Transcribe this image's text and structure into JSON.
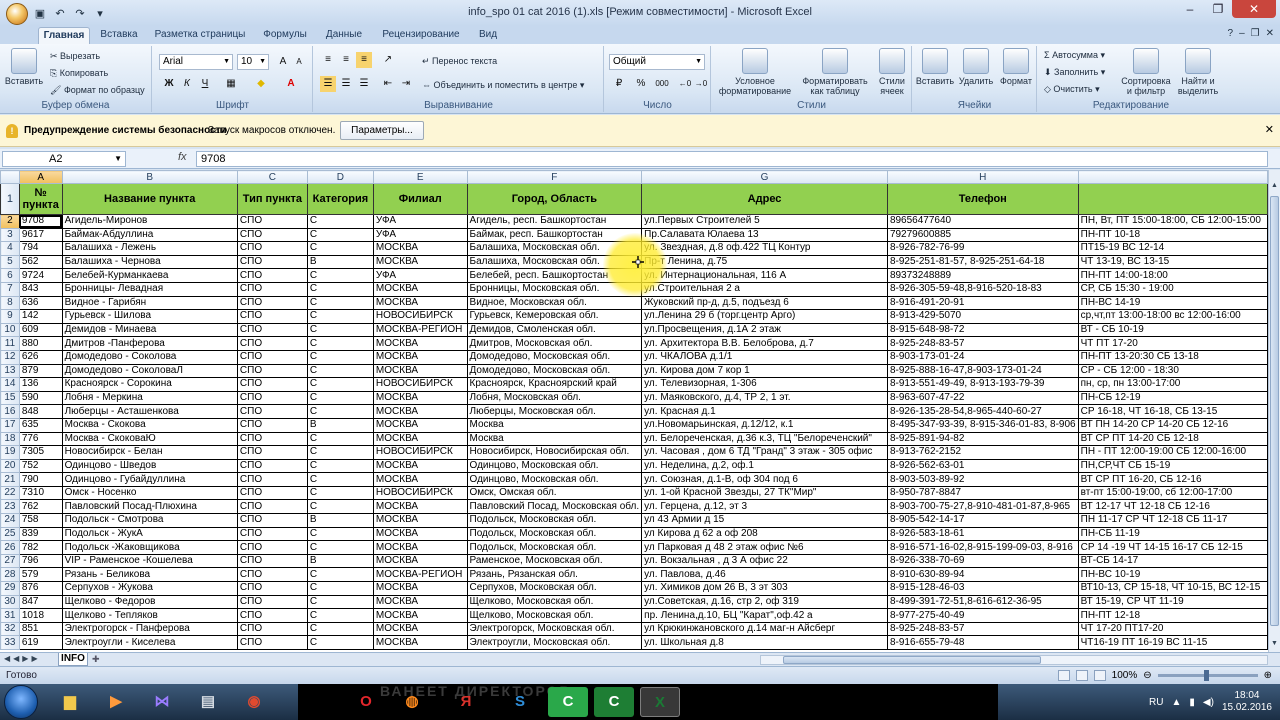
{
  "window": {
    "title": "info_spo 01 cat 2016 (1).xls [Режим совместимости] - Microsoft Excel",
    "quick_access": [
      "save-icon",
      "undo-icon",
      "redo-icon"
    ]
  },
  "ribbon_tabs": [
    "Главная",
    "Вставка",
    "Разметка страницы",
    "Формулы",
    "Данные",
    "Рецензирование",
    "Вид"
  ],
  "ribbon": {
    "clipboard": {
      "paste": "Вставить",
      "cut": "Вырезать",
      "copy": "Копировать",
      "format_painter": "Формат по образцу",
      "label": "Буфер обмена"
    },
    "font": {
      "name": "Arial",
      "size": "10",
      "bold": "Ж",
      "italic": "К",
      "underline": "Ч",
      "label": "Шрифт"
    },
    "alignment": {
      "wrap": "Перенос текста",
      "merge": "Объединить и поместить в центре",
      "label": "Выравнивание"
    },
    "number": {
      "format": "Общий",
      "percent": "%",
      "thousands": "000",
      "label": "Число"
    },
    "styles": {
      "conditional": "Условное форматирование",
      "table": "Форматировать как таблицу",
      "cell": "Стили ячеек",
      "label": "Стили"
    },
    "cells": {
      "insert": "Вставить",
      "delete": "Удалить",
      "format": "Формат",
      "label": "Ячейки"
    },
    "editing": {
      "autosum": "Автосумма",
      "fill": "Заполнить",
      "clear": "Очистить",
      "sort": "Сортировка и фильтр",
      "find": "Найти и выделить",
      "label": "Редактирование"
    }
  },
  "security_bar": {
    "title": "Предупреждение системы безопасности",
    "text": "Запуск макросов отключен.",
    "button": "Параметры..."
  },
  "formula_bar": {
    "name_box": "A2",
    "fx": "fx",
    "content": "9708"
  },
  "columns": [
    "A",
    "B",
    "C",
    "D",
    "E",
    "F",
    "G",
    "H"
  ],
  "header_row": [
    "№ пункта",
    "Название пункта",
    "Тип пункта",
    "Категория",
    "Филиал",
    "Город, Область",
    "Адрес",
    "Телефон",
    ""
  ],
  "rows": [
    [
      "9708",
      "Агидель-Миронов",
      "СПО",
      "С",
      "УФА",
      "Агидель, респ. Башкортостан",
      "ул.Первых Строителей 5",
      "89656477640",
      "ПН, Вт, ПТ 15:00-18:00, СБ 12:00-15:00"
    ],
    [
      "9617",
      "Баймак-Абдуллина",
      "СПО",
      "С",
      "УФА",
      "Баймак, респ. Башкортостан",
      "Пр.Салавата Юлаева 13",
      "79279600885",
      "ПН-ПТ 10-18"
    ],
    [
      "794",
      "Балашиха - Лежень",
      "СПО",
      "С",
      "МОСКВА",
      "Балашиха, Московская обл.",
      "ул. Звездная, д.8 оф.422 ТЦ Контур",
      "8-926-782-76-99",
      "ПТ15-19  ВС 12-14"
    ],
    [
      "562",
      "Балашиха - Чернова",
      "СПО",
      "В",
      "МОСКВА",
      "Балашиха, Московская обл.",
      "Пр-т Ленина, д.75",
      "8-925-251-81-57, 8-925-251-64-18",
      "ЧТ 13-19, ВС 13-15"
    ],
    [
      "9724",
      "Белебей-Курманкаева",
      "СПО",
      "С",
      "УФА",
      "Белебей, респ. Башкортостан",
      "ул. Интернациональная, 116 А",
      "89373248889",
      "ПН-ПТ 14:00-18:00"
    ],
    [
      "843",
      "Бронницы- Левадная",
      "СПО",
      "С",
      "МОСКВА",
      "Бронницы, Московская обл.",
      "ул.Строительная  2 а",
      "8-926-305-59-48,8-916-520-18-83",
      "СР, СБ 15:30 - 19:00"
    ],
    [
      "636",
      "Видное - Гарибян",
      "СПО",
      "С",
      "МОСКВА",
      "Видное, Московская обл.",
      "Жуковский пр-д, д.5, подъезд 6",
      "8-916-491-20-91",
      "ПН-ВС 14-19"
    ],
    [
      "142",
      "Гурьевск - Шилова",
      "СПО",
      "С",
      "НОВОСИБИРСК",
      "Гурьевск, Кемеровская обл.",
      "ул.Ленина 29 б (торг.центр Арго)",
      "8-913-429-5070",
      "ср,чт,пт 13:00-18:00 вс 12:00-16:00"
    ],
    [
      "609",
      "Демидов - Минаева",
      "СПО",
      "С",
      "МОСКВА-РЕГИОН",
      "Демидов, Смоленская обл.",
      "ул.Просвещения, д.1А   2 этаж",
      "8-915-648-98-72",
      "ВТ - СБ 10-19"
    ],
    [
      "880",
      "Дмитров -Панферова",
      "СПО",
      "С",
      "МОСКВА",
      "Дмитров, Московская обл.",
      "  ул. Архитектора В.В. Белоброва, д.7",
      "8-925-248-83-57",
      "ЧТ ПТ 17-20"
    ],
    [
      "626",
      "Домодедово - Соколова",
      "СПО",
      "С",
      "МОСКВА",
      "Домодедово, Московская обл.",
      "ул. ЧКАЛОВА  д.1/1",
      "8-903-173-01-24",
      "ПН-ПТ 13-20:30 СБ 13-18"
    ],
    [
      "879",
      "Домодедово - СоколоваЛ",
      "СПО",
      "С",
      "МОСКВА",
      "Домодедово, Московская обл.",
      "ул. Кирова дом 7 кор 1",
      "8-925-888-16-47,8-903-173-01-24",
      "СР - СБ 12:00 - 18:30"
    ],
    [
      "136",
      "Красноярск - Сорокина",
      "СПО",
      "С",
      "НОВОСИБИРСК",
      "Красноярск, Красноярский край",
      "ул. Телевизорная, 1-306",
      "8-913-551-49-49, 8-913-193-79-39",
      "пн, ср, пн 13:00-17:00"
    ],
    [
      "590",
      "Лобня - Меркина",
      "СПО",
      "С",
      "МОСКВА",
      "Лобня, Московская обл.",
      "ул. Маяковского, д.4, ТР 2, 1 эт.",
      "8-963-607-47-22",
      "ПН-СБ 12-19"
    ],
    [
      "848",
      "Люберцы - Асташенкова",
      "СПО",
      "С",
      "МОСКВА",
      "Люберцы, Московская обл.",
      "ул. Красная д.1",
      "8-926-135-28-54,8-965-440-60-27",
      "СР 16-18, ЧТ 16-18, СБ 13-15"
    ],
    [
      "635",
      "Москва - Скокова",
      "СПО",
      "В",
      "МОСКВА",
      "Москва",
      "ул.Новомарьинская, д.12/12, к.1",
      "8-495-347-93-39, 8-915-346-01-83, 8-906",
      "ВТ ПН 14-20 СР 14-20 СБ 12-16"
    ],
    [
      "776",
      "Москва - СкоковаЮ",
      "СПО",
      "С",
      "МОСКВА",
      "Москва",
      "ул. Белореченская, д.36 к.3, ТЦ \"Белореченский\"",
      "8-925-891-94-82",
      "ВТ СР ПТ 14-20 СБ 12-18"
    ],
    [
      "7305",
      "Новосибирск - Белан",
      "СПО",
      "С",
      "НОВОСИБИРСК",
      "Новосибирск, Новосибирская обл.",
      "ул. Часовая , дом 6 ТД \"Гранд\" 3 этаж - 305 офис",
      "8-913-762-2152",
      "ПН - ПТ 12:00-19:00 СБ 12:00-16:00"
    ],
    [
      "752",
      "Одинцово - Шведов",
      "СПО",
      "С",
      "МОСКВА",
      "Одинцово, Московская обл.",
      "ул. Неделина, д.2, оф.1",
      "8-926-562-63-01",
      "ПН,СР,ЧТ СБ 15-19"
    ],
    [
      "790",
      "Одинцово - Губайдуллина",
      "СПО",
      "С",
      "МОСКВА",
      "Одинцово, Московская обл.",
      "ул. Союзная, д.1-В, оф 304 под 6",
      "8-903-503-89-92",
      "ВТ СР ПТ 16-20, СБ 12-16"
    ],
    [
      "7310",
      "Омск -  Носенко",
      "СПО",
      "С",
      "НОВОСИБИРСК",
      "Омск, Омская обл.",
      "ул. 1-ой Красной Звезды, 27 ТК\"Мир\"",
      "8-950-787-8847",
      "вт-пт 15:00-19:00, сб 12:00-17:00"
    ],
    [
      "762",
      "Павловский Посад-Плюхина",
      "СПО",
      "С",
      "МОСКВА",
      "Павловский Посад, Московская обл.",
      "ул. Герцена, д.12, эт 3",
      "8-903-700-75-27,8-910-481-01-87,8-965",
      "ВТ 12-17 ЧТ 12-18 СБ 12-16"
    ],
    [
      "758",
      "Подольск - Смотрова",
      "СПО",
      "В",
      "МОСКВА",
      "Подольск, Московская обл.",
      "ул 43 Армии д 15",
      "8-905-542-14-17",
      "ПН 11-17  СР ЧТ 12-18 СБ 11-17"
    ],
    [
      "839",
      "Подольск - ЖукА",
      "СПО",
      "С",
      "МОСКВА",
      "Подольск, Московская обл.",
      "ул Кирова д 62 а оф 208",
      "8-926-583-18-61",
      "ПН-СБ 11-19"
    ],
    [
      "782",
      "Подольск -Жаковщикова",
      "СПО",
      "С",
      "МОСКВА",
      "Подольск, Московская обл.",
      "ул Парковая д 48 2 этаж офис №6",
      "8-916-571-16-02,8-915-199-09-03, 8-916",
      "СР 14 -19 ЧТ 14-15 16-17 СБ 12-15"
    ],
    [
      "796",
      "VIP - Раменское -Кошелева",
      "СПО",
      "В",
      "МОСКВА",
      "Раменское, Московская обл.",
      "ул. Вокзальная , д 3 А офис 22",
      "8-926-338-70-69",
      "ВТ-СБ 14-17"
    ],
    [
      "579",
      "Рязань - Беликова",
      "СПО",
      "С",
      "МОСКВА-РЕГИОН",
      "Рязань, Рязанская обл.",
      "ул. Павлова, д.46",
      "8-910-630-89-94",
      "ПН-ВС 10-19"
    ],
    [
      "876",
      "Серпухов - Жукова",
      "СПО",
      "С",
      "МОСКВА",
      "Серпухов, Московская обл.",
      "ул. Химиков  дом 26 В, 3 эт 303",
      "8-915-128-46-03",
      "ВТ10-13, СР 15-18, ЧТ 10-15, ВС 12-15"
    ],
    [
      "847",
      "Щелково - Федоров",
      "СПО",
      "С",
      "МОСКВА",
      "Щелково, Московская обл.",
      "ул.Советская, д.16, стр 2, оф 319",
      "8-499-391-72-51,8-616-612-36-95",
      "ВТ 15-19,  СР ЧТ 11-19"
    ],
    [
      "1018",
      "Щелково - Тепляков",
      "СПО",
      "С",
      "МОСКВА",
      "Щелково, Московская обл.",
      "пр. Ленина,д.10, БЦ \"Карат\",оф.42 а",
      "8-977-275-40-49",
      "ПН-ПТ 12-18"
    ],
    [
      "851",
      "Электрогорск - Панферова",
      "СПО",
      "С",
      "МОСКВА",
      "Электрогорск, Московская обл.",
      "ул Крюкинжановского д.14 маг-н Айсберг",
      "8-925-248-83-57",
      "ЧТ 17-20 ПТ17-20"
    ],
    [
      "619",
      "Электроугли - Киселева",
      "СПО",
      "С",
      "МОСКВА",
      "Электроугли, Московская обл.",
      "ул. Школьная д.8",
      "8-916-655-79-48",
      "ЧТ16-19 ПТ 16-19 ВС 11-15"
    ]
  ],
  "sheet_tab": "INFO",
  "status": {
    "ready": "Готово",
    "zoom": "100%"
  },
  "taskbar": {
    "banner": "ВАНЕЕТ ДИРЕКТОРОВ",
    "lang": "RU",
    "time": "18:04",
    "date": "15.02.2016"
  },
  "colors": {
    "header_fill": "#92d050",
    "highlight": "#ffeb28"
  }
}
